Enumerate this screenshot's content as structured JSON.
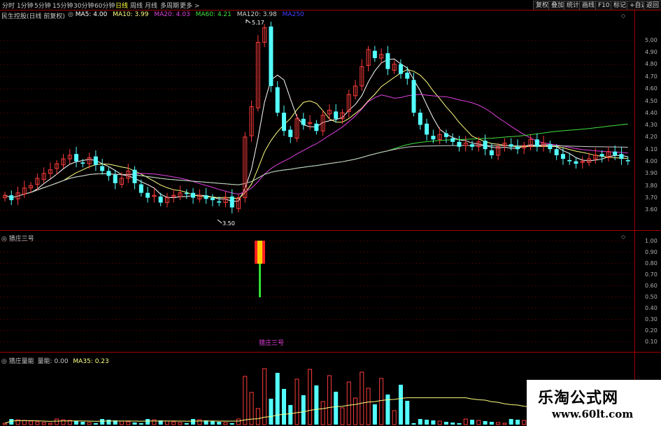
{
  "periods": [
    "分时",
    "1分钟",
    "5分钟",
    "15分钟",
    "30分钟",
    "60分钟",
    "日线",
    "周线",
    "月线",
    "多周期",
    "更多 >"
  ],
  "active_period": "日线",
  "toolbar": [
    "复权",
    "叠加",
    "统计",
    "画线",
    "F10",
    "标记",
    "+自选",
    "返回"
  ],
  "main": {
    "title": "民生控股(日线 前复权)",
    "ma": [
      {
        "label": "MA5: 4.00",
        "color": "#ffffff"
      },
      {
        "label": "MA10: 3.99",
        "color": "#ffff80"
      },
      {
        "label": "MA20: 4.03",
        "color": "#e040e0"
      },
      {
        "label": "MA60: 4.21",
        "color": "#40e040"
      },
      {
        "label": "MA120: 3.98",
        "color": "#d0d0d0"
      },
      {
        "label": "MA250",
        "color": "#4040ff"
      }
    ],
    "high_label": "5.17",
    "low_label": "3.50",
    "yticks": [
      "5.00",
      "4.90",
      "4.80",
      "4.70",
      "4.60",
      "4.50",
      "4.40",
      "4.30",
      "4.20",
      "4.10",
      "4.00",
      "3.90",
      "3.80",
      "3.70",
      "3.60"
    ]
  },
  "ind1": {
    "title": "猎庄三号",
    "label": "猎庄三号",
    "yticks": [
      "1.00",
      "0.90",
      "0.80",
      "0.70",
      "0.60",
      "0.50",
      "0.40",
      "0.30",
      "0.20",
      "0.10"
    ]
  },
  "ind2": {
    "title": "猎庄量能",
    "sub": "量能: 0.00",
    "ma": "MA35: 0.23"
  },
  "watermark": {
    "title": "乐淘公式网",
    "url": "www.60lt.com"
  },
  "colors": {
    "up": "#ff3c3c",
    "down": "#54ffff",
    "grid": "#a00000",
    "ma_white": "#ffffff",
    "ma_yellow": "#ffff80",
    "ma_purple": "#e040e0",
    "ma_green": "#40e040"
  }
}
